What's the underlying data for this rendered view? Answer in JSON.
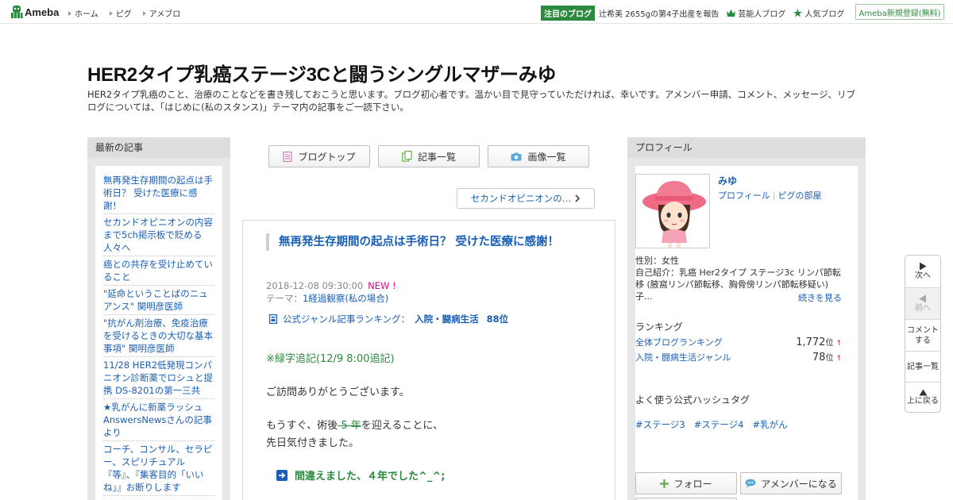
{
  "header": {
    "logo_text": "Ameba",
    "nav": [
      "ホーム",
      "ピグ",
      "アメブロ"
    ],
    "featured_badge": "注目のブログ",
    "featured_text": "辻希美 2655gの第4子出産を報告",
    "link_celebrity": "芸能人ブログ",
    "link_popular": "人気ブログ",
    "signup": "Ameba新規登録(無料)"
  },
  "blog": {
    "title": "HER2タイプ乳癌ステージ3Cと闘うシングルマザーみゆ",
    "description": "HER2タイプ乳癌のこと、治療のことなどを書き残しておこうと思います。ブログ初心者です。温かい目で見守っていただければ、幸いです。アメンバー申請、コメント、メッセージ、リブログについては、「はじめに(私のスタンス)」テーマ内の記事をご一読下さい。"
  },
  "left": {
    "heading": "最新の記事",
    "items": [
      "無再発生存期間の起点は手術日？ 受けた医療に感謝！",
      "セカンドオピニオンの内容まで5ch掲示板で貶める人々へ",
      "癌との共存を受け止めていること",
      "\"延命ということばのニュアンス\" 関明彦医師",
      "\"抗がん剤治療、免疫治療を受けるときの大切な基本事項\" 関明彦医師",
      "11/28 HER2低発現コンパニオン診断薬でロシュと提携 DS-8201の第一三共",
      "★乳がんに新薬ラッシュ AnswersNewsさんの記事より",
      "コーチ、コンサル、セラピー、スピリチュアル『等』、『集客目的「いいね」』お断りします"
    ]
  },
  "center": {
    "tab_top": "ブログトップ",
    "tab_list": "記事一覧",
    "tab_images": "画像一覧",
    "prev_post": "セカンドオピニオンの…",
    "article": {
      "title": "無再発生存期間の起点は手術日？ 受けた医療に感謝！",
      "datetime": "2018-12-08 09:30:00",
      "new_label": "NEW !",
      "theme_label": "テーマ：",
      "theme": "1経過観察(私の場合)",
      "rank_label": "公式ジャンル記事ランキング：",
      "rank_genre": "入院・闘病生活",
      "rank_value": "88位",
      "addendum": "※緑字追記(12/9 8:00追記)",
      "para1": "ご訪問ありがとうございます。",
      "para2_a": "もうすぐ、術後",
      "para2_strike": " 5 年",
      "para2_b": "を迎えることに、",
      "para3": "先日気付きました。",
      "note": "間違えました、４年でした^_^;"
    }
  },
  "right": {
    "heading": "プロフィール",
    "name": "みゆ",
    "link_profile": "プロフィール",
    "link_pig": "ピグの部屋",
    "gender": "性別：女性",
    "intro": "自己紹介：乳癌 Her2タイプ ステージ3c リンパ節転移 (腋窩リンパ節転移、胸骨傍リンパ節転移疑い) 子...",
    "more": "続きを見る",
    "ranking_heading": "ランキング",
    "ranks": [
      {
        "label": "全体ブログランキング",
        "value": "1,772",
        "unit": "位",
        "trend": "↑"
      },
      {
        "label": "入院・闘病生活ジャンル",
        "value": "78",
        "unit": "位",
        "trend": "↑"
      }
    ],
    "hashtag_heading": "よく使う公式ハッシュタグ",
    "hashtags": [
      "#ステージ3",
      "#ステージ4",
      "#乳がん"
    ],
    "follow": "フォロー",
    "member": "アメンバーになる"
  },
  "floatnav": {
    "next": "次へ",
    "prev": "前へ",
    "comment_1": "コメント",
    "comment_2": "する",
    "list": "記事一覧",
    "top": "上に戻る"
  },
  "colors": {
    "ameba_green": "#2b8a3e",
    "link_blue": "#1a5fb4",
    "new_pink": "#e4007f"
  }
}
